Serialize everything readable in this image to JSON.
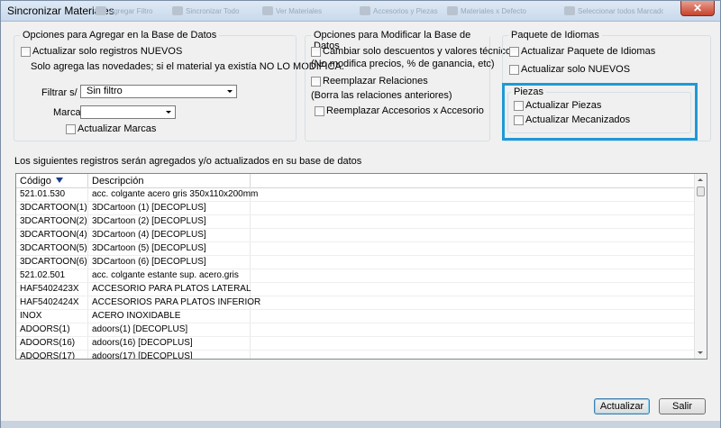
{
  "window": {
    "title": "Sincronizar Materiales",
    "close_glyph": "✕",
    "background_toolbar": [
      "Agregar Filtro",
      "Sincronizar Todo",
      "Ver Materiales",
      "Accesorios y Piezas",
      "Materiales x Defecto",
      "Seleccionar todos Marcados"
    ]
  },
  "group_agregar": {
    "label": "Opciones para Agregar en la Base de Datos",
    "chk_nuevos_label": "Actualizar solo registros NUEVOS",
    "note": "Solo agrega las novedades; si el material ya existía NO LO MODIFICA.",
    "filtrar_label": "Filtrar s/ :",
    "filtrar_value": "Sin filtro",
    "marca_label": "Marca:",
    "marca_value": "",
    "chk_marcas_label": "Actualizar Marcas"
  },
  "group_modificar": {
    "label": "Opciones para Modificar la Base de Datos",
    "chk_descuentos_label": "Cambiar solo descuentos y valores técnicos",
    "descuentos_note": "(No modifica precios, % de ganancia, etc)",
    "chk_relaciones_label": "Reemplazar Relaciones",
    "relaciones_note": "(Borra las relaciones anteriores)",
    "chk_accesorios_label": "Reemplazar Accesorios x Accesorio"
  },
  "group_idiomas": {
    "label": "Paquete de Idiomas",
    "chk_paquete_label": "Actualizar Paquete de Idiomas",
    "chk_nuevos_label": "Actualizar solo NUEVOS"
  },
  "group_piezas": {
    "label": "Piezas",
    "chk_piezas_label": "Actualizar Piezas",
    "chk_mecanizados_label": "Actualizar Mecanizados"
  },
  "list": {
    "caption": "Los siguientes registros serán agregados y/o actualizados en su base de datos",
    "columns": [
      "Código",
      "Descripción"
    ],
    "rows": [
      [
        "521.01.530",
        "acc. colgante acero gris 350x110x200mm"
      ],
      [
        "3DCARTOON(1)",
        "3DCartoon (1)  [DECOPLUS]"
      ],
      [
        "3DCARTOON(2)",
        "3DCartoon (2)  [DECOPLUS]"
      ],
      [
        "3DCARTOON(4)",
        "3DCartoon (4)  [DECOPLUS]"
      ],
      [
        "3DCARTOON(5)",
        "3DCartoon (5)  [DECOPLUS]"
      ],
      [
        "3DCARTOON(6)",
        "3DCartoon (6)  [DECOPLUS]"
      ],
      [
        "521.02.501",
        "acc. colgante estante sup. acero.gris"
      ],
      [
        "HAF5402423X",
        "ACCESORIO PARA PLATOS LATERAL"
      ],
      [
        "HAF5402424X",
        "ACCESORIOS PARA PLATOS INFERIOR"
      ],
      [
        "INOX",
        "ACERO INOXIDABLE"
      ],
      [
        "ADOORS(1)",
        "adoors(1)  [DECOPLUS]"
      ],
      [
        "ADOORS(16)",
        "adoors(16)  [DECOPLUS]"
      ],
      [
        "ADOORS(17)",
        "adoors(17)  [DECOPLUS]"
      ]
    ]
  },
  "buttons": {
    "actualizar": "Actualizar",
    "salir": "Salir"
  }
}
